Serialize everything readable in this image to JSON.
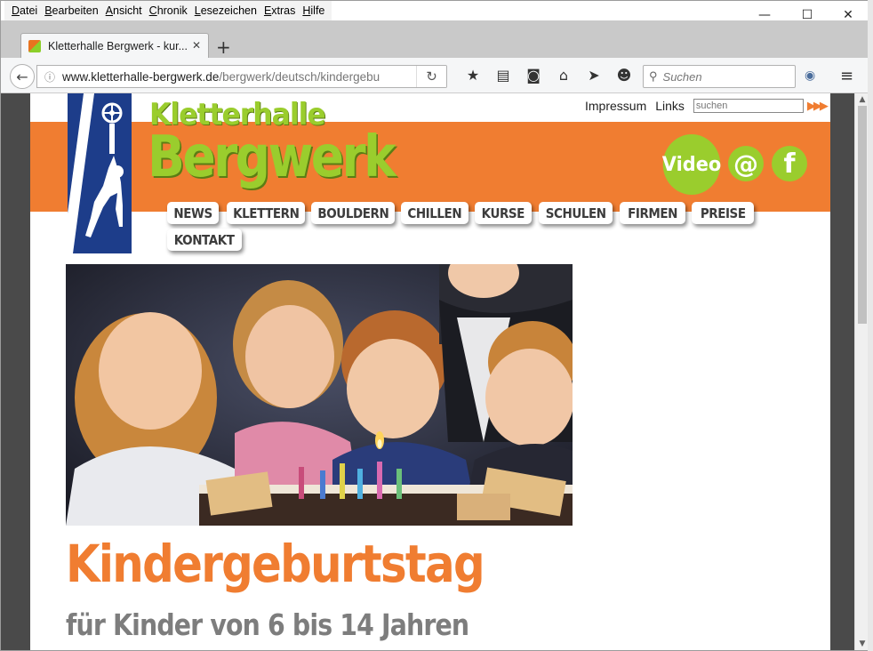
{
  "menubar": {
    "items": [
      "Datei",
      "Bearbeiten",
      "Ansicht",
      "Chronik",
      "Lesezeichen",
      "Extras",
      "Hilfe"
    ]
  },
  "window_controls": {
    "minimize": "—",
    "maximize": "☐",
    "close": "✕"
  },
  "tab": {
    "title": "Kletterhalle Bergwerk - kur...",
    "close": "✕"
  },
  "new_tab": "+",
  "navbar": {
    "back": "←",
    "info": "ⓘ",
    "url_domain": "www.kletterhalle-bergwerk.de",
    "url_path": "/bergwerk/deutsch/kindergebu",
    "reload": "↻",
    "search_placeholder": "Suchen",
    "search_icon": "🔍",
    "hamburger": "≡"
  },
  "toolbar_icons": [
    "★",
    "▤",
    "◙",
    "⌂",
    "➤",
    "☻"
  ],
  "site": {
    "title_small": "Kletterhalle",
    "title_big": "Bergwerk",
    "top_links": {
      "impressum": "Impressum",
      "links": "Links"
    },
    "search_placeholder": "suchen",
    "search_go": "▶▶▶",
    "video_button": "Video",
    "at_button": "@",
    "facebook_button": "f",
    "nav": [
      "NEWS",
      "KLETTERN",
      "BOULDERN",
      "CHILLEN",
      "KURSE",
      "SCHULEN",
      "FIRMEN",
      "PREISE",
      "KONTAKT"
    ],
    "heading": "Kindergeburtstag",
    "subheading": "für Kinder von 6 bis 14 Jahren"
  },
  "colors": {
    "brand_orange": "#f07d31",
    "brand_green": "#9acd2d",
    "logo_blue": "#1d3d8a"
  }
}
